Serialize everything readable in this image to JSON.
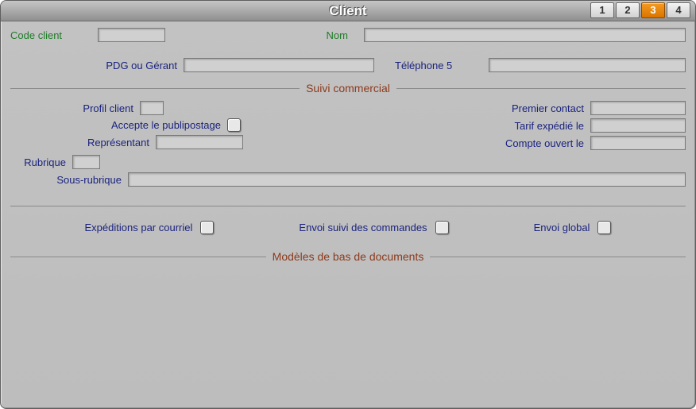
{
  "titlebar": {
    "title": "Client",
    "tabs": [
      "1",
      "2",
      "3",
      "4"
    ],
    "active_tab": 3
  },
  "header": {
    "code_client_label": "Code client",
    "code_client_value": "",
    "nom_label": "Nom",
    "nom_value": ""
  },
  "row_pdg": {
    "pdg_label": "PDG ou Gérant",
    "pdg_value": "",
    "tel5_label": "Téléphone 5",
    "tel5_value": ""
  },
  "suivi": {
    "legend": "Suivi commercial",
    "profil_label": "Profil client",
    "profil_value": "",
    "accepte_label": "Accepte le publipostage",
    "accepte_checked": false,
    "representant_label": "Représentant",
    "representant_value": "",
    "premier_contact_label": "Premier contact",
    "premier_contact_value": "",
    "tarif_label": "Tarif expédié le",
    "tarif_value": "",
    "compte_label": "Compte ouvert le",
    "compte_value": "",
    "rubrique_label": "Rubrique",
    "rubrique_value": "",
    "sous_rubrique_label": "Sous-rubrique",
    "sous_rubrique_value": ""
  },
  "emails": {
    "exp_courriel_label": "Expéditions par courriel",
    "exp_courriel_checked": false,
    "envoi_suivi_label": "Envoi suivi des commandes",
    "envoi_suivi_checked": false,
    "envoi_global_label": "Envoi global",
    "envoi_global_checked": false
  },
  "modeles": {
    "legend": "Modèles de bas de documents"
  }
}
